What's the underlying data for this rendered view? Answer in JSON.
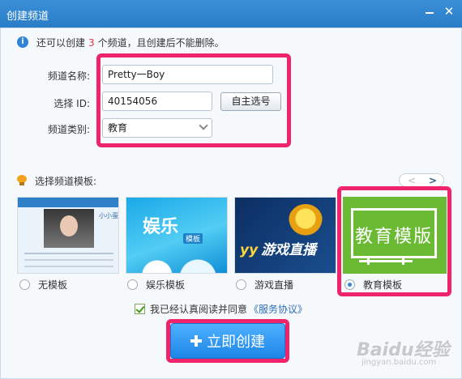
{
  "window": {
    "title": "创建频道",
    "minimize_icon": "minimize-icon",
    "close_icon": "close-icon",
    "close_glyph": "✕"
  },
  "info": {
    "prefix": "还可以创建",
    "count": "3",
    "suffix": "个频道，且创建后不能删除。",
    "icon": "info-icon"
  },
  "form": {
    "name_label": "频道名称:",
    "name_value": "Pretty一Boy",
    "id_label": "选择 ID:",
    "id_value": "40154056",
    "select_id_button": "自主选号",
    "category_label": "频道类别:",
    "category_value": "教育"
  },
  "templates": {
    "header": "选择频道模板:",
    "pager_prev": "<",
    "pager_next": ">",
    "items": [
      {
        "label": "无模板",
        "selected": false
      },
      {
        "label": "娱乐模板",
        "selected": false
      },
      {
        "label": "游戏直播",
        "selected": false
      },
      {
        "label": "教育模板",
        "selected": true
      }
    ],
    "thumb1_name": "小小蛋",
    "thumb2_text": "娱乐",
    "thumb2_sub": "模板",
    "thumb3_brand": "yy",
    "thumb3_text": "游戏直播",
    "thumb4_text": "教育模版"
  },
  "agreement": {
    "text": "我已经认真阅读并同意",
    "link": "《服务协议》",
    "checked": true
  },
  "create_button": {
    "label": "立即创建"
  },
  "colors": {
    "titlebar": "#2a7cc7",
    "highlight_box": "#f0246b",
    "create_button": "#1c85e6",
    "edu_template": "#6bba33",
    "count_highlight": "#e03a3a"
  },
  "watermark": {
    "text": "Baidu经验",
    "sub": "jingyan.baidu.com"
  }
}
